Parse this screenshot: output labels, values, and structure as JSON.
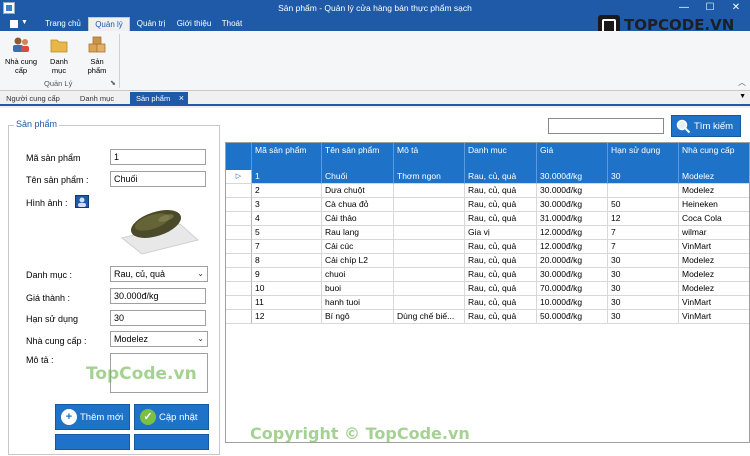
{
  "window": {
    "title": "Sản phẩm - Quản lý cửa hàng bán thực phẩm sạch",
    "minimize": "—",
    "maximize": "☐",
    "close": "✕"
  },
  "menu": {
    "tabs": [
      {
        "label": "Trang chủ"
      },
      {
        "label": "Quản lý"
      },
      {
        "label": "Quản trị"
      },
      {
        "label": "Giới thiệu"
      },
      {
        "label": "Thoát"
      }
    ]
  },
  "ribbon": {
    "buttons": [
      {
        "label": "Nhà cung cấp",
        "icon": "suppliers-icon"
      },
      {
        "label": "Danh mục",
        "icon": "folder-icon"
      },
      {
        "label": "Sản phẩm",
        "icon": "boxes-icon"
      }
    ],
    "group": "Quản Lý"
  },
  "doc_tabs": [
    {
      "label": "Người cung cấp"
    },
    {
      "label": "Danh mục"
    },
    {
      "label": "Sản phẩm"
    }
  ],
  "form": {
    "group_title": "Sản phẩm",
    "ma_label": "Mã sản phẩm",
    "ma_value": "1",
    "ten_label": "Tên sản phẩm :",
    "ten_value": "Chuối",
    "hinh_label": "Hình ảnh :",
    "danhmuc_label": "Danh mục :",
    "danhmuc_value": "Rau, củ, quả",
    "gia_label": "Giá thành :",
    "gia_value": "30.000đ/kg",
    "han_label": "Hạn sử dụng",
    "han_value": "30",
    "ncc_label": "Nhà cung cấp :",
    "ncc_value": "Modelez",
    "mota_label": "Mô tả :",
    "btn_add": "Thêm mới",
    "btn_update": "Cập nhật"
  },
  "search": {
    "value": "",
    "button": "Tìm kiếm"
  },
  "table": {
    "headers": [
      "Mã sản phẩm",
      "Tên sản phẩm",
      "Mô tả",
      "Danh mục",
      "Giá",
      "Hạn sử dụng",
      "Nhà cung cấp"
    ],
    "rows": [
      [
        "1",
        "Chuối",
        "Thơm ngon",
        "Rau, củ, quả",
        "30.000đ/kg",
        "30",
        "Modelez"
      ],
      [
        "2",
        "Dưa chuột",
        "",
        "Rau, củ, quả",
        "30.000đ/kg",
        "",
        "Modelez"
      ],
      [
        "3",
        "Cà chua đỏ",
        "",
        "Rau, củ, quả",
        "30.000đ/kg",
        "50",
        "Heineken"
      ],
      [
        "4",
        "Cải thảo",
        "",
        "Rau, củ, quả",
        "31.000đ/kg",
        "12",
        "Coca Cola"
      ],
      [
        "5",
        "Rau lang",
        "",
        "Gia vị",
        "12.000đ/kg",
        "7",
        "wilmar"
      ],
      [
        "7",
        "Cải cúc",
        "",
        "Rau, củ, quả",
        "12.000đ/kg",
        "7",
        "VinMart"
      ],
      [
        "8",
        "Cải chíp L2",
        "",
        "Rau, củ, quả",
        "20.000đ/kg",
        "30",
        "Modelez"
      ],
      [
        "9",
        "chuoi",
        "",
        "Rau, củ, quả",
        "30.000đ/kg",
        "30",
        "Modelez"
      ],
      [
        "10",
        "buoi",
        "",
        "Rau, củ, quả",
        "70.000đ/kg",
        "30",
        "Modelez"
      ],
      [
        "11",
        "hanh tuoi",
        "",
        "Rau, củ, quả",
        "10.000đ/kg",
        "30",
        "VinMart"
      ],
      [
        "12",
        "Bí ngô",
        "Dùng chế biế...",
        "Rau, củ, quả",
        "50.000đ/kg",
        "30",
        "VinMart"
      ]
    ],
    "selected_indicator": "▷"
  },
  "watermarks": {
    "brand": "TOPCODE.VN",
    "small": "TopCode.vn",
    "copyright": "Copyright © TopCode.vn"
  },
  "colors": {
    "accent": "#1e73c8",
    "titlebar": "#1e5aa8"
  }
}
